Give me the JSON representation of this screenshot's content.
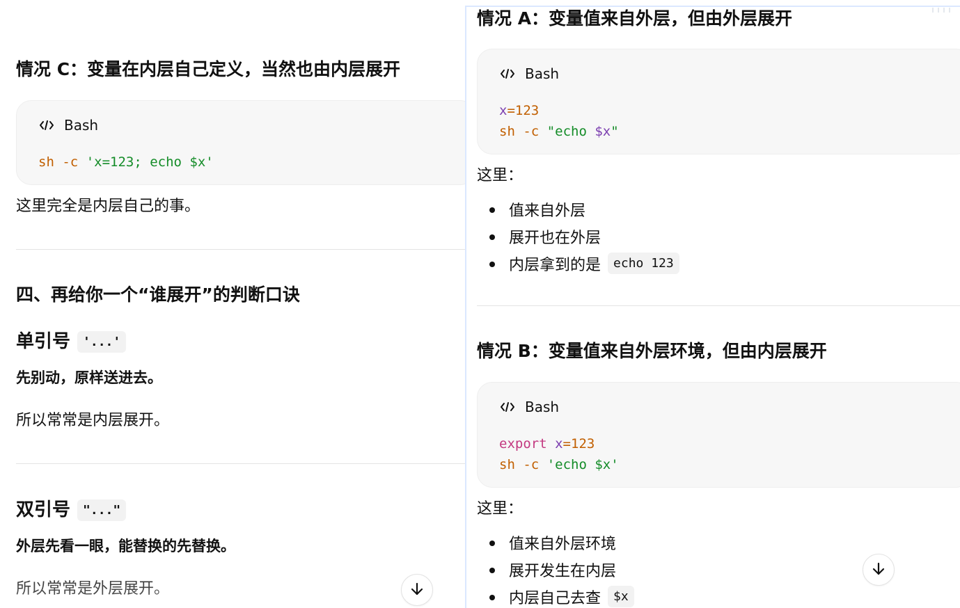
{
  "left_panel": {
    "case_c_title": "情况 C：变量在内层自己定义，当然也由内层展开",
    "case_c_code": {
      "language": "Bash",
      "line_1": {
        "command": "sh",
        "flag": "-c",
        "string": "'x=123; echo $x'"
      }
    },
    "case_c_text": "这里完全是内层自己的事。",
    "section_four_title": "四、再给你一个“谁展开”的判断口诀",
    "single_quote": {
      "label": "单引号",
      "code": "'...'",
      "bold_text": "先别动，原样送进去。",
      "text": "所以常常是内层展开。"
    },
    "double_quote": {
      "label": "双引号",
      "code": "\"...\"",
      "bold_text": "外层先看一眼，能替换的先替换。",
      "text": "所以常常是外层展开。"
    }
  },
  "right_panel": {
    "case_a_title": "情况 A：变量值来自外层，但由外层展开",
    "case_a_code": {
      "language": "Bash",
      "line_1": {
        "name": "x",
        "operator": "=",
        "value": "123"
      },
      "line_2": {
        "command": "sh",
        "flag": "-c",
        "string_prefix": "\"echo ",
        "variable": "$x",
        "string_suffix": "\""
      }
    },
    "case_a_here": "这里：",
    "case_a_bullets": {
      "item_1": "值来自外层",
      "item_2": "展开也在外层",
      "item_3_text": "内层拿到的是",
      "item_3_code": "echo 123"
    },
    "case_b_title": "情况 B：变量值来自外层环境，但由内层展开",
    "case_b_code": {
      "language": "Bash",
      "line_1": {
        "keyword": "export",
        "name": "x",
        "operator": "=",
        "value": "123"
      },
      "line_2": {
        "command": "sh",
        "flag": "-c",
        "string": "'echo $x'"
      }
    },
    "case_b_here": "这里：",
    "case_b_bullets": {
      "item_1": "值来自外层环境",
      "item_2": "展开发生在内层",
      "item_3_text": "内层自己去查",
      "item_3_code": "$x"
    }
  },
  "icons": {
    "code": "code-icon",
    "scroll_down": "arrow-down-icon"
  },
  "colors": {
    "code_background": "#f7f7f7",
    "code_command": "#c15f00",
    "code_string": "#148c28",
    "code_variable": "#7c3fb0",
    "code_keyword": "#c33980",
    "selection_border": "#dbe8ff"
  }
}
